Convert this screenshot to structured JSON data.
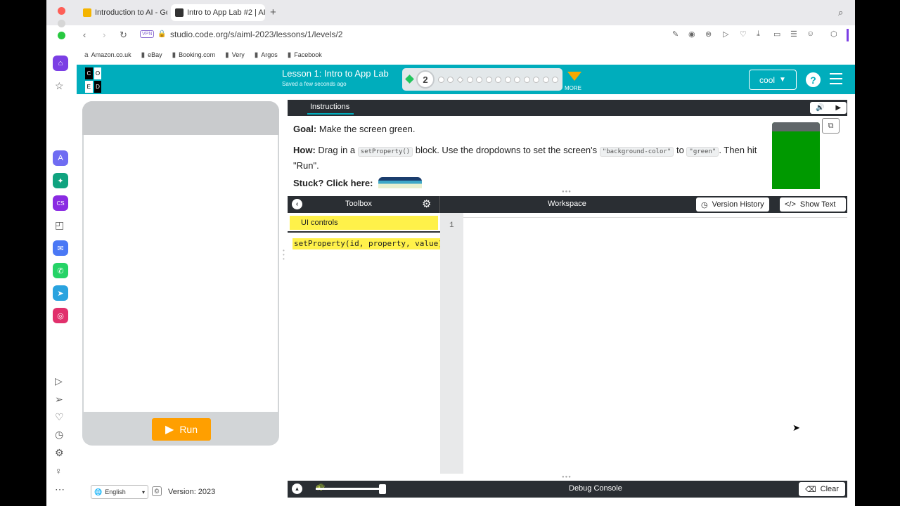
{
  "browser": {
    "tabs": [
      {
        "title": "Introduction to AI - Goo",
        "favicon_color": "#f4b400"
      },
      {
        "title": "Intro to App Lab #2 | AI",
        "favicon_color": "#333333"
      }
    ],
    "new_tab": "+",
    "url": "studio.code.org/s/aiml-2023/lessons/1/levels/2",
    "vpn_badge": "VPN",
    "bookmarks": [
      "Amazon.co.uk",
      "eBay",
      "Booking.com",
      "Very",
      "Argos",
      "Facebook"
    ]
  },
  "header": {
    "logo_letters": [
      "C",
      "O",
      "D",
      "E"
    ],
    "lesson_title": "Lesson 1: Intro to App Lab",
    "saved_status": "Saved a few seconds ago",
    "current_level": "2",
    "more_label": "MORE",
    "user_name": "cool",
    "help_label": "?",
    "brand_color": "#00adbc"
  },
  "preview": {
    "run_label": "Run",
    "run_color": "#ff9f00"
  },
  "footer": {
    "language": "English",
    "copyright_symbol": "©",
    "version": "Version: 2023"
  },
  "instructions": {
    "tab_label": "Instructions",
    "goal_label": "Goal:",
    "goal_text": "Make the screen green.",
    "how_label": "How:",
    "how_part1": "Drag in a",
    "how_code1": "setProperty()",
    "how_part2": "block. Use the dropdowns to set the screen's",
    "how_code2": "\"background-color\"",
    "how_part3": "to",
    "how_code3": "\"green\"",
    "how_part4": ". Then hit \"Run\".",
    "stuck_label": "Stuck? Click here:",
    "target_color": "#009900"
  },
  "toolbox": {
    "title": "Toolbox",
    "category": "UI controls",
    "block_text": "setProperty(id, property, value)"
  },
  "workspace": {
    "title": "Workspace",
    "version_history_label": "Version History",
    "show_text_label": "Show Text",
    "line_number": "1"
  },
  "debug": {
    "title": "Debug Console",
    "clear_label": "Clear"
  }
}
